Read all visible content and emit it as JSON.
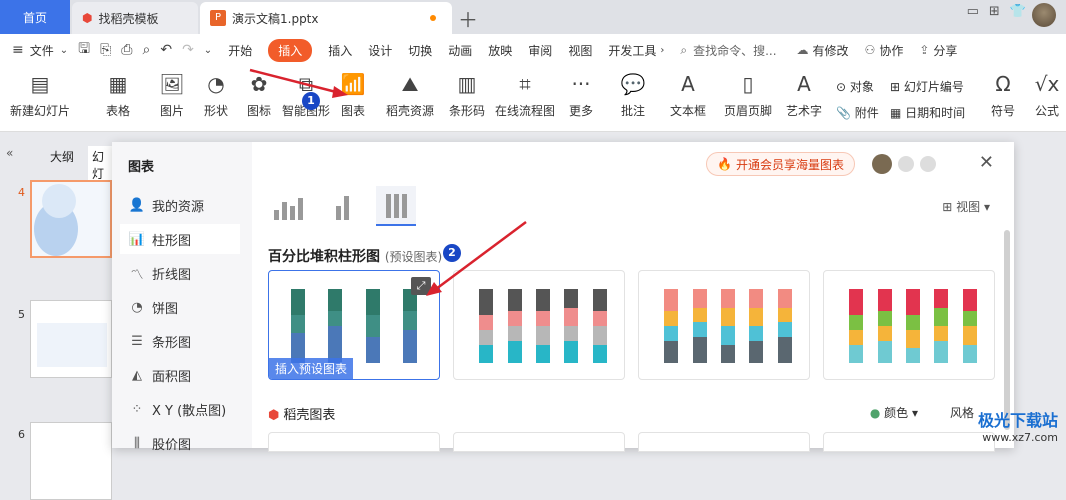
{
  "tabs": {
    "home": "首页",
    "template": "找稻壳模板",
    "doc": "演示文稿1.pptx"
  },
  "menu": {
    "file": "文件",
    "items": [
      "开始",
      "插入",
      "设计",
      "切换",
      "动画",
      "放映",
      "审阅",
      "视图",
      "开发工具"
    ],
    "active": "插入",
    "search": "查找命令、搜...",
    "modify": "有修改",
    "collab": "协作",
    "share": "分享"
  },
  "ribbon": {
    "new_slide": "新建幻灯片",
    "table": "表格",
    "picture": "图片",
    "shape": "形状",
    "icon": "图标",
    "smartart": "智能图形",
    "chart": "图表",
    "docer": "稻壳资源",
    "barcode": "条形码",
    "flowchart": "在线流程图",
    "more": "更多",
    "comment": "批注",
    "textbox": "文本框",
    "header_footer": "页眉页脚",
    "wordart": "艺术字",
    "object": "对象",
    "attach": "附件",
    "slide_num": "幻灯片编号",
    "datetime": "日期和时间",
    "symbol": "符号",
    "formula": "公式"
  },
  "left": {
    "outline": "大纲",
    "slides": "幻灯",
    "nums": [
      "4",
      "5",
      "6"
    ]
  },
  "dialog": {
    "title": "图表",
    "vip": "开通会员享海量图表",
    "view": "视图",
    "side": [
      "我的资源",
      "柱形图",
      "折线图",
      "饼图",
      "条形图",
      "面积图",
      "X Y (散点图)",
      "股价图"
    ],
    "section_title": "百分比堆积柱形图",
    "section_sub": "(预设图表)",
    "insert_preset": "插入预设图表",
    "docer_charts": "稻壳图表",
    "color": "颜色",
    "style": "风格"
  },
  "annotations": [
    "1",
    "2"
  ],
  "watermark": {
    "name": "极光下载站",
    "url": "www.xz7.com"
  },
  "colors": {
    "accent": "#3c73e8",
    "insert_tab": "#f25c2a",
    "arrow": "#d9232e"
  }
}
